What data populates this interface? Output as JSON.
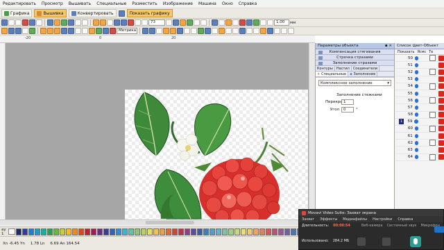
{
  "menu": [
    "Редактировать",
    "Просмотр",
    "Вышивать",
    "Специальные",
    "Разместить",
    "Изображение",
    "Машина",
    "Окно",
    "Справка"
  ],
  "tabs": {
    "graphics": "Графика",
    "embroidery": "Вышивка",
    "convert": "Конвертировать",
    "show_graphics": "Показать графику"
  },
  "toolbar": {
    "stitch_value": "73",
    "density_value": "1.00",
    "density_unit": "мм",
    "measure_unit": "Метрика"
  },
  "ruler": {
    "marks": [
      "-20",
      "0",
      "20"
    ]
  },
  "left_edge_text": "ау 1",
  "status": {
    "x": "Хn  -6.45 Yn",
    "w": "1.78 Ln",
    "h": "6.69 An  164.54"
  },
  "object_panel": {
    "title": "Параметры объекта",
    "bars": [
      "Компенсация стягивания",
      "Строчка стразами",
      "Заполнение стразами"
    ],
    "tabs_row1": [
      "Контуры",
      "Настил",
      "Соединители"
    ],
    "tabs_row2": [
      "Специальные",
      "Заполнение"
    ],
    "combo_value": "Комплексное заполнение",
    "group_label": "Заполнение стежками",
    "overlap_label": "Перекрытие",
    "overlap_value": "1",
    "angle_label": "Угол",
    "angle_value": "0",
    "angle_unit": "°"
  },
  "color_list": {
    "title": "Список Цвет-Объект",
    "col1": "Показать",
    "col2": "Ясмс",
    "col3": "Те",
    "rows": [
      "50",
      "51",
      "52",
      "53",
      "54",
      "55",
      "56",
      "57",
      "58",
      "59",
      "60",
      "61",
      "62",
      "63",
      "64"
    ],
    "selected_index": "1"
  },
  "video_dialog": {
    "title": "Movavi Video Suite: Захват экрана",
    "tabs": [
      "Захват",
      "Эффекты",
      "Медиафайлы",
      "Настройки",
      "Справка"
    ],
    "duration_label": "Длительность:",
    "duration_value": "00:00:54",
    "webcam_label": "Веб-камера",
    "system_sound_label": "Системный звук",
    "mic_label": "Микрофон",
    "used_label": "Использовано:",
    "used_value": "284.2 МБ"
  },
  "palette_colors": [
    "#1f2a6b",
    "#2a3f9a",
    "#1e7fd1",
    "#14a0c8",
    "#0fb3a0",
    "#2aa14a",
    "#69b83a",
    "#c9d12a",
    "#f2c21e",
    "#f08a1a",
    "#e0461c",
    "#c81e2e",
    "#a01a5a",
    "#6e2b8f",
    "#3a3a9c",
    "#2b65c1",
    "#2d8fd6",
    "#39b2d8",
    "#62c1a3",
    "#8fc870",
    "#b7d35c",
    "#e6e05a",
    "#f3c44b",
    "#ee9d41",
    "#e06b3a",
    "#d04437",
    "#b73451",
    "#8f3d8c",
    "#5c4a9e",
    "#3c5aa8",
    "#3d7cc0",
    "#4f9dd1",
    "#63b4c8",
    "#7fc1a6",
    "#a1cf88",
    "#c7d97a",
    "#e8df7b",
    "#f2ca6b",
    "#eea660",
    "#e2805b",
    "#cf5c58",
    "#b95274",
    "#98569c",
    "#6f61a7",
    "#4f72b3",
    "#5f8fc6",
    "#74acd0"
  ]
}
